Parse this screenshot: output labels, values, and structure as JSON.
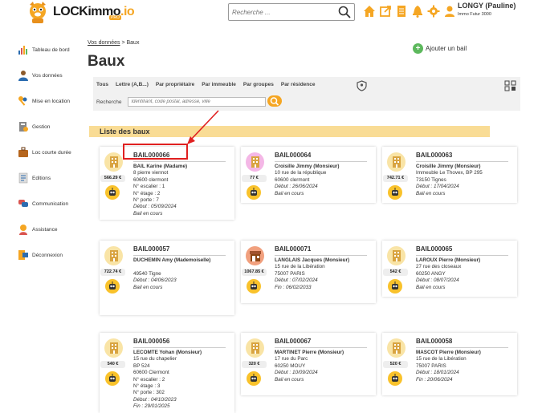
{
  "app": {
    "logo": "LOCKimmo",
    "logo_suffix": ".io",
    "logo_badge": "PRO"
  },
  "header": {
    "search_placeholder": "Recherche ...",
    "user_name": "LONGY (Pauline)",
    "user_org": "Immo Futur 3000"
  },
  "sidebar": {
    "items": [
      {
        "label": "Tableau de bord",
        "icon": "dashboard-icon"
      },
      {
        "label": "Vos données",
        "icon": "user-data-icon"
      },
      {
        "label": "Mise en location",
        "icon": "keys-icon"
      },
      {
        "label": "Gestion",
        "icon": "management-icon"
      },
      {
        "label": "Loc courte durée",
        "icon": "suitcase-icon"
      },
      {
        "label": "Editions",
        "icon": "editions-icon"
      },
      {
        "label": "Communication",
        "icon": "chat-icon"
      },
      {
        "label": "Assistance",
        "icon": "support-icon"
      },
      {
        "label": "Déconnexion",
        "icon": "logout-icon"
      }
    ]
  },
  "breadcrumb": {
    "link": "Vos données",
    "sep": ">",
    "current": "Baux"
  },
  "page": {
    "title": "Baux",
    "add_button": "Ajouter un bail"
  },
  "filters": {
    "tabs": [
      "Tous",
      "Lettre (A,B...)",
      "Par propriétaire",
      "Par immeuble",
      "Par groupes",
      "Par résidence"
    ],
    "search_label": "Recherche",
    "search_placeholder": "Identifiant, code postal, adresse, ville"
  },
  "list": {
    "title": "Liste des baux"
  },
  "cards": [
    {
      "ref": "BAIL000066",
      "tenant": "BAIL Karine (Madame)",
      "lines": [
        "8 pierre viennot",
        "60600 clermont",
        "N° escalier : 1",
        "N° étage : 2",
        "N° porte : 7"
      ],
      "start": "Début : 05/09/2024",
      "end": "",
      "status": "Bail en cours",
      "price": "566.29 €",
      "icon": "building-icon",
      "badge": "yellow"
    },
    {
      "ref": "BAIL000064",
      "tenant": "Croisille Jimmy (Monsieur)",
      "lines": [
        "10 rue de la république",
        "60600 clermont"
      ],
      "start": "Début : 26/06/2024",
      "end": "",
      "status": "Bail en cours",
      "price": "77 €",
      "icon": "building-icon",
      "badge": "pink"
    },
    {
      "ref": "BAIL000063",
      "tenant": "Croisille Jimmy (Monsieur)",
      "lines": [
        "Immeuble Le Thovex, BP 295",
        "73150 Tignes"
      ],
      "start": "Début : 17/04/2024",
      "end": "",
      "status": "Bail en cours",
      "price": "742.71 €",
      "icon": "building-icon",
      "badge": "yellow"
    },
    {
      "ref": "BAIL000057",
      "tenant": "DUCHEMIN Amy (Mademoiselle)",
      "lines": [
        "",
        "49540 Tigne"
      ],
      "start": "Début : 04/06/2023",
      "end": "",
      "status": "Bail en cours",
      "price": "722.74 €",
      "icon": "building-icon",
      "badge": "yellow"
    },
    {
      "ref": "BAIL000071",
      "tenant": "LANGLAIS Jacques (Monsieur)",
      "lines": [
        "15 rue de la Libération",
        "75007 PARIS"
      ],
      "start": "Début : 07/02/2024",
      "end": "Fin : 06/02/2033",
      "status": "",
      "price": "1067.85 €",
      "icon": "shop-icon",
      "badge": "orange"
    },
    {
      "ref": "BAIL000065",
      "tenant": "LAROUX Pierre (Monsieur)",
      "lines": [
        "27 rue des closeaux",
        "60250 ANGY"
      ],
      "start": "Début : 08/07/2024",
      "end": "",
      "status": "Bail en cours",
      "price": "542 €",
      "icon": "building-icon",
      "badge": "yellow"
    },
    {
      "ref": "BAIL000056",
      "tenant": "LECOMTE Yohan (Monsieur)",
      "lines": [
        "15 rue du chapelier",
        "BP 524",
        "60600 Clermont",
        "N° escalier : 2",
        "N° étage : 3",
        "N° porte : 302"
      ],
      "start": "Début : 04/10/2023",
      "end": "Fin : 29/01/2025",
      "status": "",
      "price": "540 €",
      "icon": "building-icon",
      "badge": "yellow"
    },
    {
      "ref": "BAIL000067",
      "tenant": "MARTINET Pierre (Monsieur)",
      "lines": [
        "17 rue du Parc",
        "60250 MOUY"
      ],
      "start": "Début : 10/09/2024",
      "end": "",
      "status": "Bail en cours",
      "price": "320 €",
      "icon": "building-icon",
      "badge": "yellow"
    },
    {
      "ref": "BAIL000058",
      "tenant": "MASCOT Pierre (Monsieur)",
      "lines": [
        "15 rue de la Libération",
        "75007 PARIS"
      ],
      "start": "Début : 18/01/2024",
      "end": "Fin : 20/06/2024",
      "status": "",
      "price": "520 €",
      "icon": "building-icon",
      "badge": "yellow"
    }
  ],
  "colors": {
    "accent_orange": "#f5a623",
    "list_header_bg": "#f9dc95",
    "highlight_red": "#e02020",
    "add_green": "#5cb85c"
  }
}
